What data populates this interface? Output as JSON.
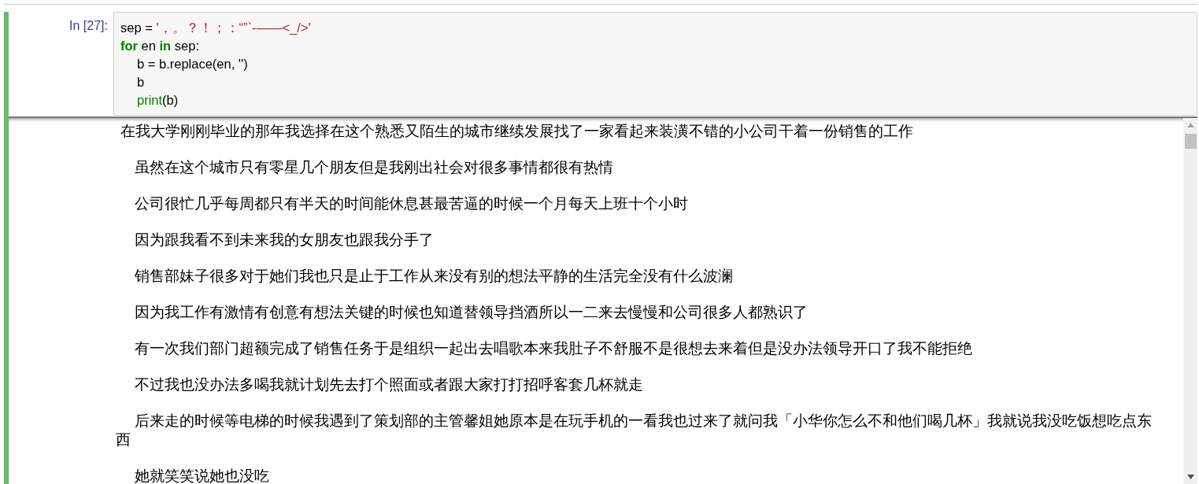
{
  "cell": {
    "prompt": "In [27]:",
    "code": [
      {
        "indent": false,
        "tokens": [
          {
            "kind": "plain",
            "text": "sep = "
          },
          {
            "kind": "string",
            "text": "'，。？！；：“”`-——<_/>'"
          }
        ]
      },
      {
        "indent": false,
        "tokens": [
          {
            "kind": "keyword",
            "text": "for"
          },
          {
            "kind": "plain",
            "text": " en "
          },
          {
            "kind": "keyword",
            "text": "in"
          },
          {
            "kind": "plain",
            "text": " sep:"
          }
        ]
      },
      {
        "indent": true,
        "tokens": [
          {
            "kind": "plain",
            "text": "b = b.replace(en, '')"
          }
        ]
      },
      {
        "indent": true,
        "tokens": [
          {
            "kind": "plain",
            "text": "b"
          }
        ]
      },
      {
        "indent": true,
        "tokens": [
          {
            "kind": "builtin",
            "text": "print"
          },
          {
            "kind": "plain",
            "text": "(b)"
          }
        ]
      }
    ],
    "output": [
      " 在我大学刚刚毕业的那年我选择在这个熟悉又陌生的城市继续发展找了一家看起来装潢不错的小公司干着一份销售的工作",
      "    虽然在这个城市只有零星几个朋友但是我刚出社会对很多事情都很有热情",
      "    公司很忙几乎每周都只有半天的时间能休息甚最苦逼的时候一个月每天上班十个小时",
      "    因为跟我看不到未来我的女朋友也跟我分手了",
      "    销售部妹子很多对于她们我也只是止于工作从来没有别的想法平静的生活完全没有什么波澜",
      "    因为我工作有激情有创意有想法关键的时候也知道替领导挡酒所以一二来去慢慢和公司很多人都熟识了",
      "    有一次我们部门超额完成了销售任务于是组织一起出去唱歌本来我肚子不舒服不是很想去来着但是没办法领导开口了我不能拒绝",
      "    不过我也没办法多喝我就计划先去打个照面或者跟大家打打招呼客套几杯就走",
      "    后来走的时候等电梯的时候我遇到了策划部的主管馨姐她原本是在玩手机的一看我也过来了就问我「小华你怎么不和他们喝几杯」我就说我没吃饭想吃点东西",
      "    她就笑笑说她也没吃"
    ]
  }
}
